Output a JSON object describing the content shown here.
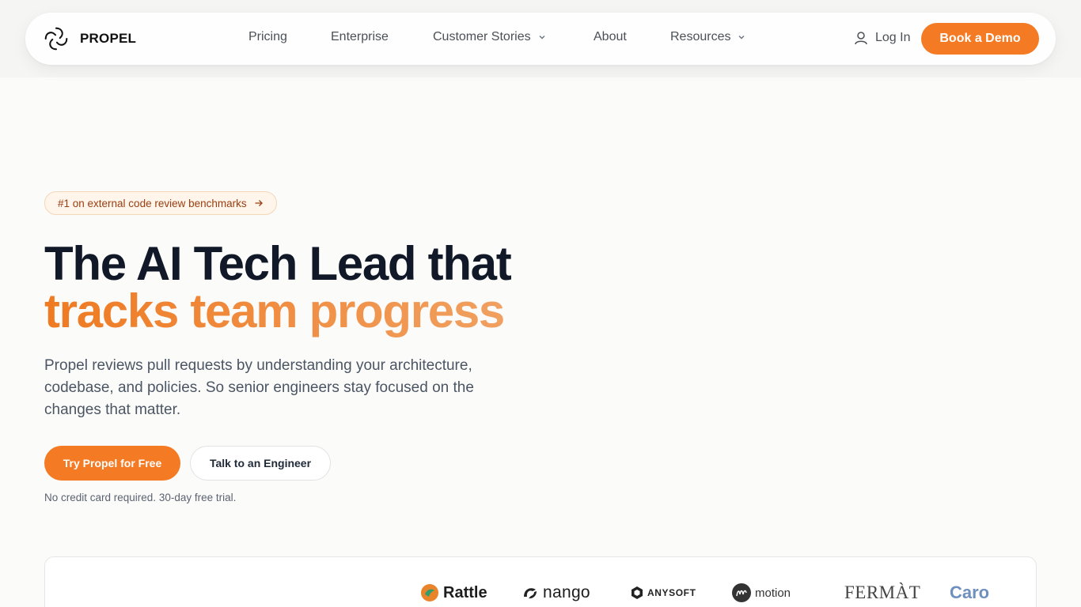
{
  "brand": {
    "name": "PROPEL",
    "accent_color": "#f47a23"
  },
  "nav": {
    "items": [
      {
        "label": "Pricing",
        "has_dropdown": false
      },
      {
        "label": "Enterprise",
        "has_dropdown": false
      },
      {
        "label": "Customer Stories",
        "has_dropdown": true
      },
      {
        "label": "About",
        "has_dropdown": false
      },
      {
        "label": "Resources",
        "has_dropdown": true
      }
    ],
    "login_label": "Log In",
    "demo_label": "Book a Demo"
  },
  "hero": {
    "badge": "#1 on external code review benchmarks",
    "headline_line1": "The AI Tech Lead that",
    "headline_line2": "tracks team progress",
    "subtext": "Propel reviews pull requests by understanding your architecture, codebase, and policies. So senior engineers stay focused on the changes that matter.",
    "primary_cta": "Try Propel for Free",
    "secondary_cta": "Talk to an Engineer",
    "note": "No credit card required. 30-day free trial."
  },
  "customer_logos": [
    "Rattle",
    "nango",
    "ANYSOFT",
    "motion",
    "FERMÀT",
    "Caro"
  ],
  "icons": {
    "brand": "propel-logo-icon",
    "user": "user-icon",
    "dropdown": "chevron-down-icon",
    "badge_arrow": "arrow-right-icon"
  }
}
